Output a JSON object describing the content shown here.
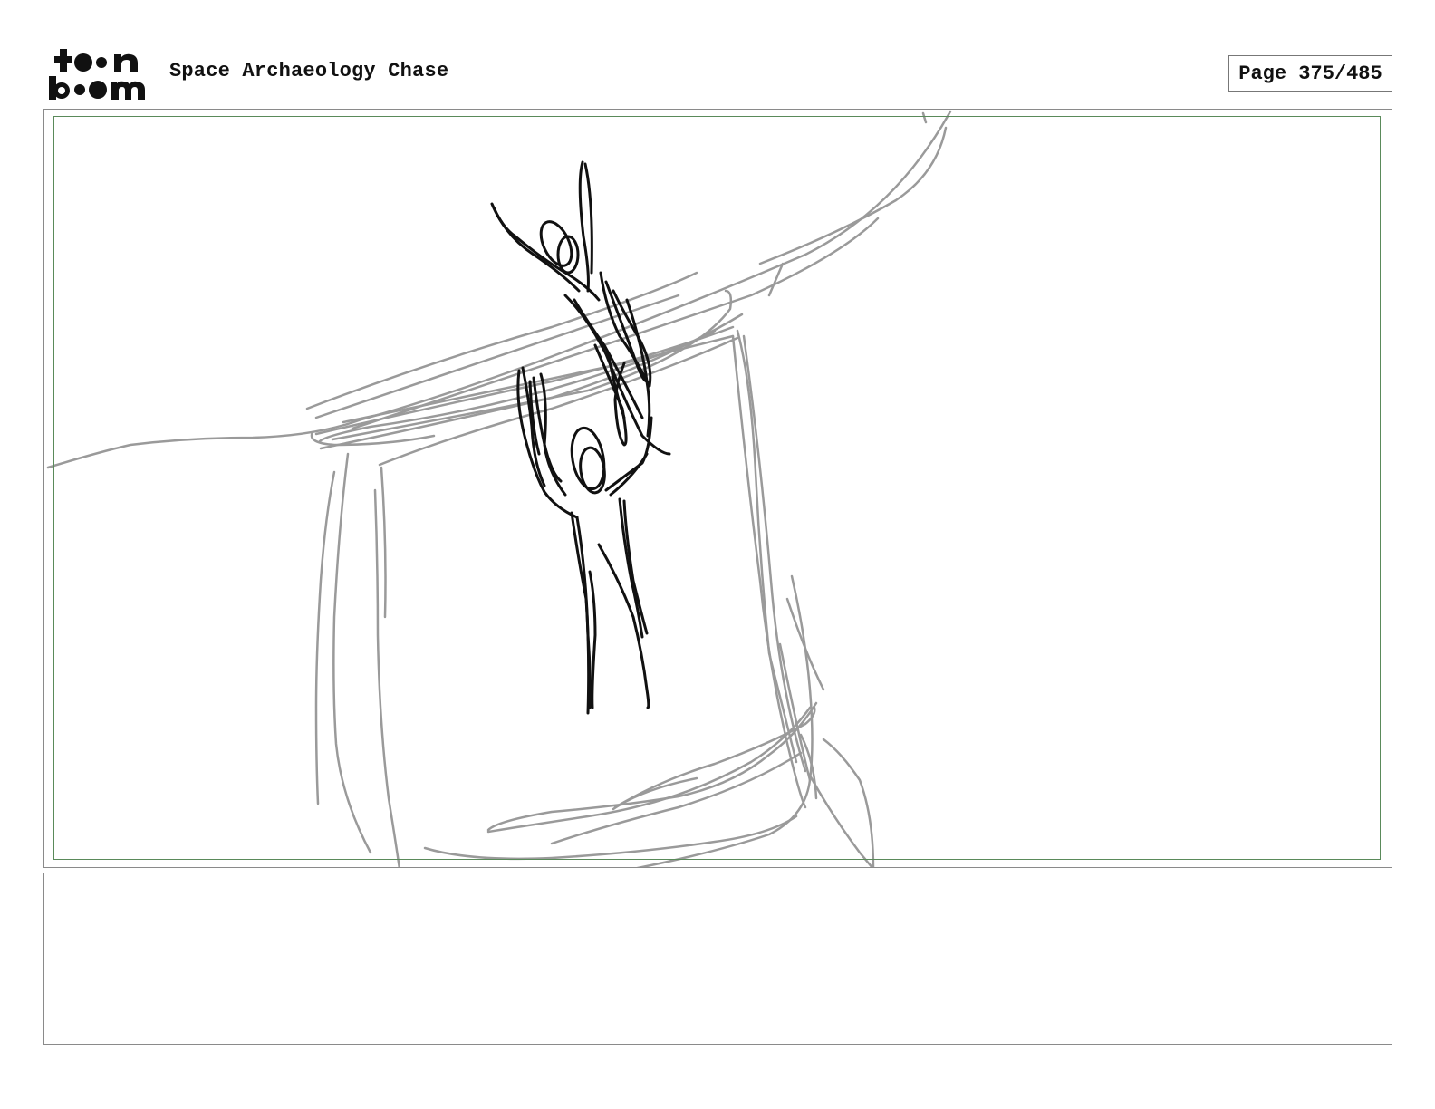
{
  "header": {
    "logo_top": "t●●n",
    "logo_bottom": "b●●m",
    "project_title": "Space Archaeology Chase",
    "page_label": "Page 375/485"
  },
  "panel": {
    "sketch_icon": "storyboard-sketch-figure-hanging",
    "line_colors": {
      "background": "#999999",
      "character": "#111111",
      "safe_area": "#5a8a5a"
    }
  },
  "notes": {
    "text": ""
  }
}
